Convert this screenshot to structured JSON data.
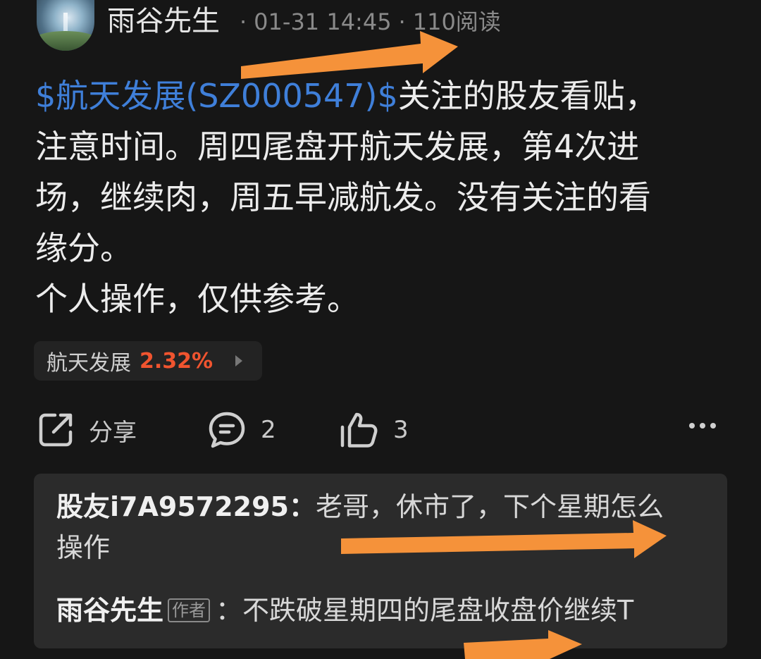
{
  "post": {
    "author": "雨谷先生",
    "date": "01-31 14:45",
    "reads": "110阅读",
    "separator": "·",
    "body": {
      "stock_link": "$航天发展(SZ000547)$",
      "line1_rest": "关注的股友看贴，",
      "line2": "注意时间。周四尾盘开航天发展，第4次进",
      "line3": "场，继续肉，周五早减航发。没有关注的看",
      "line4": "缘分。",
      "line5": "个人操作，仅供参考。"
    }
  },
  "stock_chip": {
    "name": "航天发展",
    "change": "2.32%",
    "change_color": "#f0542f"
  },
  "actions": {
    "share_label": "分享",
    "comment_count": "2",
    "like_count": "3"
  },
  "comments": [
    {
      "user": "股友i7A9572295",
      "colon": "：",
      "text_line1": "老哥，休市了，下个星期怎么",
      "text_line2": "操作"
    },
    {
      "user": "雨谷先生",
      "badge": "作者",
      "colon": "：",
      "text": "不跌破星期四的尾盘收盘价继续T"
    }
  ],
  "colors": {
    "background": "#161616",
    "link": "#3f7fd9",
    "annotation_arrow": "#f5923a"
  }
}
